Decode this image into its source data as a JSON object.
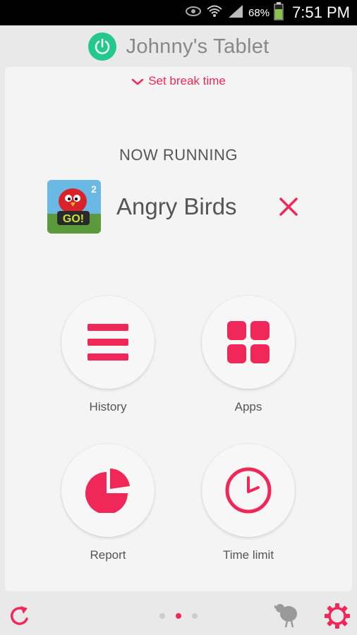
{
  "status_bar": {
    "battery": "68%",
    "time": "7:51 PM"
  },
  "header": {
    "device_name": "Johnny's Tablet"
  },
  "break": {
    "label": "Set break time"
  },
  "now_running": {
    "heading": "NOW RUNNING",
    "app_name": "Angry Birds"
  },
  "tiles": {
    "history": "History",
    "apps": "Apps",
    "report": "Report",
    "time_limit": "Time limit"
  },
  "colors": {
    "accent": "#f0285a",
    "power": "#22c98a"
  },
  "pager": {
    "count": 3,
    "active_index": 1
  }
}
